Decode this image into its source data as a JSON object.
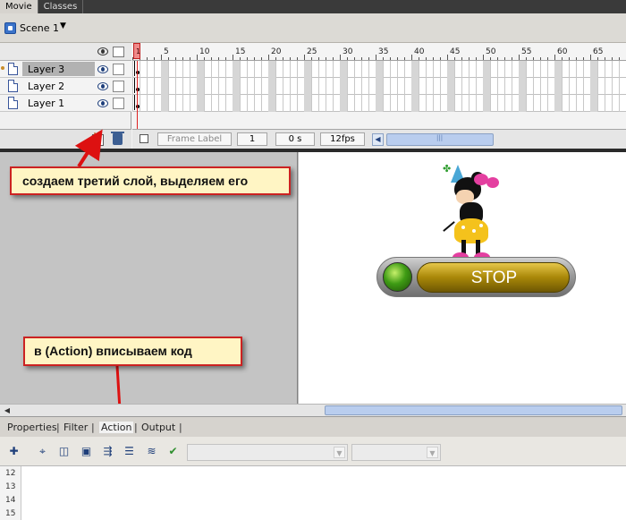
{
  "doc_tabs": [
    "Movie",
    "Classes"
  ],
  "scene": {
    "label": "Scene 1",
    "caret": "▼"
  },
  "layers": [
    {
      "name": "Layer 3",
      "selected": true
    },
    {
      "name": "Layer 2",
      "selected": false
    },
    {
      "name": "Layer 1",
      "selected": false
    }
  ],
  "timeline": {
    "ruler_numbers": [
      "5",
      "10",
      "15",
      "20",
      "25",
      "30",
      "35",
      "40",
      "45",
      "50",
      "55",
      "60",
      "65"
    ],
    "playhead_frame": "1",
    "frame_label_placeholder": "Frame Label",
    "current_frame": "1",
    "current_time": "0 s",
    "fps": "12fps"
  },
  "stage": {
    "button_text": "STOP"
  },
  "callouts": {
    "layer_note": "создаем третий слой, выделяем его",
    "action_note": "в (Action) вписываем код"
  },
  "panel_tabs": [
    "Properties",
    "Filter",
    "Action",
    "Output"
  ],
  "active_panel_tab": "Action",
  "code": {
    "line_numbers": [
      "12",
      "13",
      "14",
      "15"
    ]
  },
  "colors": {
    "callout_border": "#cc2222",
    "callout_bg": "#fff5c4",
    "arrow": "#dd1111",
    "playhead": "#dd2222"
  }
}
